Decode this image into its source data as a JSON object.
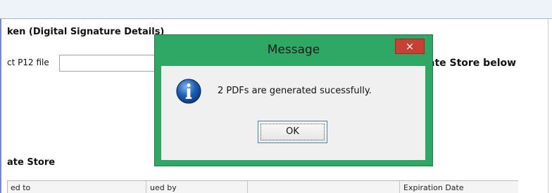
{
  "background": {
    "section_title": "ken (Digital Signature Details)",
    "p12_label": "ct P12 file",
    "p12_input_value": "",
    "store_below_label": "ate Store below",
    "cert_store_label": "ate Store",
    "table_headers": [
      "ed to",
      "ued by",
      "",
      "Expiration Date"
    ]
  },
  "dialog": {
    "title": "Message",
    "close_glyph": "×",
    "icon": "info-icon",
    "message": "2 PDFs are generated sucessfully.",
    "ok_label": "OK",
    "colors": {
      "frame": "#2fa765",
      "close_button": "#c64034",
      "body": "#f0f0f0",
      "icon": "#1c5fb3"
    }
  }
}
